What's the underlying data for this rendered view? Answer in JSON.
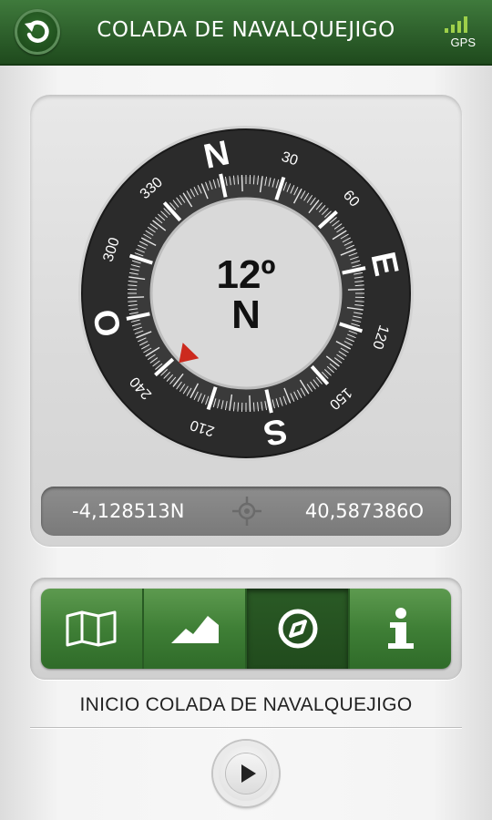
{
  "header": {
    "title": "COLADA DE NAVALQUEJIGO",
    "back_icon": "back-arrow-icon",
    "gps_label": "GPS",
    "gps_bars_filled": 4,
    "gps_bars_total": 4
  },
  "compass": {
    "heading_value": "12º",
    "heading_direction": "N",
    "cardinals": [
      "N",
      "E",
      "S",
      "O"
    ],
    "degree_labels": [
      "30",
      "60",
      "120",
      "150",
      "210",
      "240",
      "300",
      "330"
    ],
    "needle_color": "#cc2a1e"
  },
  "coordinates": {
    "latitude": "-4,128513N",
    "longitude": "40,587386O",
    "center_icon": "crosshair-icon"
  },
  "tabs": [
    {
      "icon": "map-icon",
      "active": false
    },
    {
      "icon": "elevation-profile-icon",
      "active": false
    },
    {
      "icon": "compass-icon",
      "active": true
    },
    {
      "icon": "info-icon",
      "active": false
    }
  ],
  "route": {
    "name": "INICIO COLADA DE NAVALQUEJIGO"
  },
  "player": {
    "icon": "play-icon"
  },
  "colors": {
    "header_green": "#2d5f2b",
    "tab_green": "#3f7f36",
    "gps_bars": "#9ed04a"
  }
}
